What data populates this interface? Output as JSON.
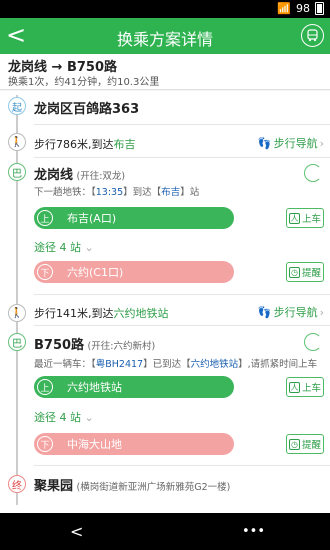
{
  "status": {
    "signal": "📶",
    "battery_level": "98"
  },
  "titlebar": {
    "title": "换乘方案详情",
    "back": "<",
    "map_icon": "bus-icon"
  },
  "summary": {
    "route": "龙岗线 → B750路",
    "detail": "换乘1次，约41分钟，约10.3公里"
  },
  "start": {
    "mark": "起",
    "name": "龙岗区百鸽路363"
  },
  "walk1": {
    "text": "步行786米,到达",
    "dest": "布吉",
    "nav": "步行导航"
  },
  "line1": {
    "mark": "巴",
    "name": "龙岗线",
    "dir": "(开往:双龙)",
    "next_prefix": "下一趟地铁：【",
    "next_time": "13:35",
    "next_mid": "】到达【",
    "next_stop": "布吉",
    "next_suffix": "】站",
    "board": "布吉(A口)",
    "board_badge": "上",
    "board_btn": "上车",
    "via": "途径 4 站",
    "alight": "六约(C1口)",
    "alight_badge": "下",
    "alight_btn": "提醒"
  },
  "walk2": {
    "text": "步行141米,到达",
    "dest": "六约地铁站",
    "nav": "步行导航"
  },
  "line2": {
    "mark": "巴",
    "name": "B750路",
    "dir": "(开往:六约新村)",
    "next_prefix": "最近一辆车：【",
    "plate": "粤BH2417",
    "next_mid": "】已到达【",
    "next_stop": "六约地铁站",
    "next_suffix": "】,请抓紧时间上车",
    "board": "六约地铁站",
    "board_badge": "上",
    "board_btn": "上车",
    "via": "途径 4 站",
    "alight": "中海大山地",
    "alight_badge": "下",
    "alight_btn": "提醒"
  },
  "end": {
    "mark": "终",
    "name": "聚果园",
    "addr": "(横岗街道新亚洲广场新雅苑G2一楼)"
  },
  "navbar": {
    "back": "<",
    "menu": "•••"
  },
  "colors": {
    "accent": "#2eb350",
    "blue": "#1a5fb0",
    "alight": "#f4a3a3"
  }
}
